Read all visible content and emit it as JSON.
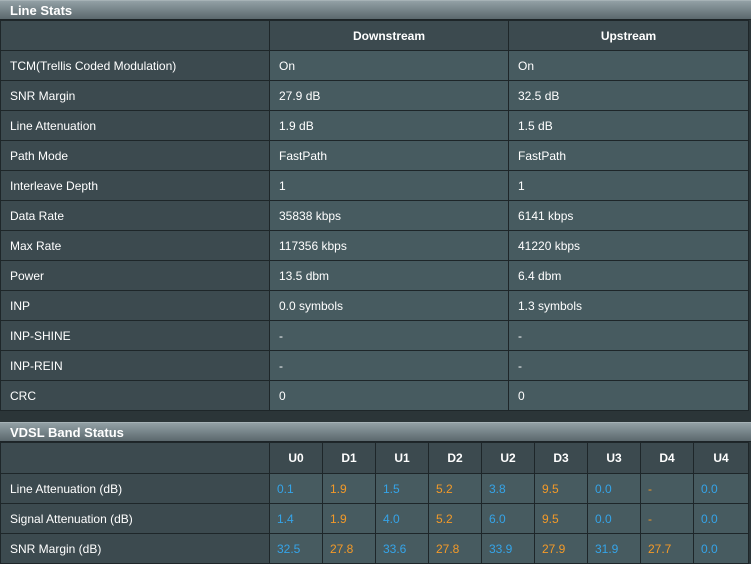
{
  "line_stats": {
    "title": "Line Stats",
    "columns": [
      "Downstream",
      "Upstream"
    ],
    "rows": [
      {
        "label": "TCM(Trellis Coded Modulation)",
        "down": "On",
        "up": "On"
      },
      {
        "label": "SNR Margin",
        "down": "27.9 dB",
        "up": "32.5 dB"
      },
      {
        "label": "Line Attenuation",
        "down": "1.9 dB",
        "up": "1.5 dB"
      },
      {
        "label": "Path Mode",
        "down": "FastPath",
        "up": "FastPath"
      },
      {
        "label": "Interleave Depth",
        "down": "1",
        "up": "1"
      },
      {
        "label": "Data Rate",
        "down": "35838 kbps",
        "up": "6141 kbps"
      },
      {
        "label": "Max Rate",
        "down": "117356 kbps",
        "up": "41220 kbps"
      },
      {
        "label": "Power",
        "down": "13.5 dbm",
        "up": "6.4 dbm"
      },
      {
        "label": "INP",
        "down": "0.0 symbols",
        "up": "1.3 symbols"
      },
      {
        "label": "INP-SHINE",
        "down": "-",
        "up": "-"
      },
      {
        "label": "INP-REIN",
        "down": "-",
        "up": "-"
      },
      {
        "label": "CRC",
        "down": "0",
        "up": "0"
      }
    ]
  },
  "band_status": {
    "title": "VDSL Band Status",
    "bands": [
      "U0",
      "D1",
      "U1",
      "D2",
      "U2",
      "D3",
      "U3",
      "D4",
      "U4"
    ],
    "rows": [
      {
        "label": "Line Attenuation (dB)",
        "values": [
          "0.1",
          "1.9",
          "1.5",
          "5.2",
          "3.8",
          "9.5",
          "0.0",
          "-",
          "0.0"
        ]
      },
      {
        "label": "Signal Attenuation (dB)",
        "values": [
          "1.4",
          "1.9",
          "4.0",
          "5.2",
          "6.0",
          "9.5",
          "0.0",
          "-",
          "0.0"
        ]
      },
      {
        "label": "SNR Margin (dB)",
        "values": [
          "32.5",
          "27.8",
          "33.6",
          "27.8",
          "33.9",
          "27.9",
          "31.9",
          "27.7",
          "0.0"
        ]
      }
    ]
  },
  "colors": {
    "upstream_value": "#35a4e8",
    "downstream_value": "#f39a28"
  }
}
